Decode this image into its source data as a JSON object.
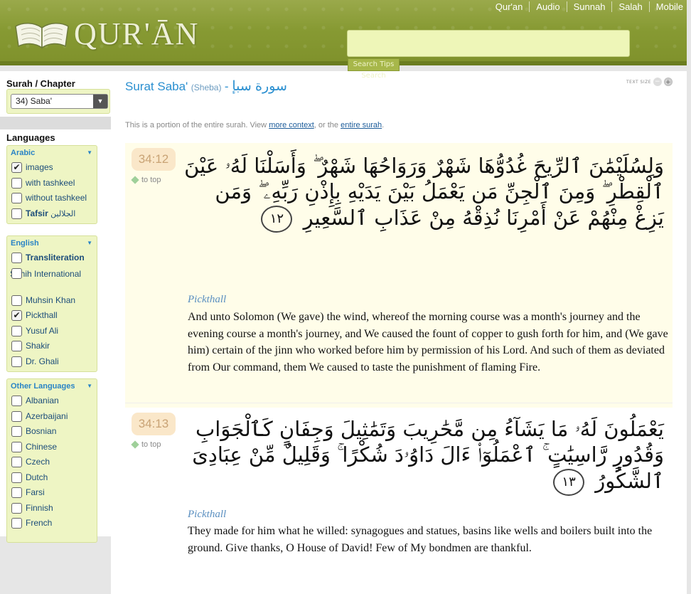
{
  "top_nav": [
    "Qur'an",
    "Audio",
    "Sunnah",
    "Salah",
    "Mobile"
  ],
  "logo": {
    "text": "QUR'ĀN"
  },
  "search": {
    "placeholder": "",
    "button_label": "Search Tips Search"
  },
  "sidebar": {
    "surah_heading": "Surah / Chapter",
    "surah_selected": "34) Saba'",
    "languages_heading": "Languages",
    "groups": [
      {
        "title": "Arabic",
        "items": [
          {
            "label": "images",
            "checked": true
          },
          {
            "label": "with tashkeel",
            "checked": false
          },
          {
            "label": "without tashkeel",
            "checked": false
          },
          {
            "label": "Tafsir",
            "extra": "الجلالين",
            "checked": false,
            "bold": true
          }
        ]
      },
      {
        "title": "English",
        "items": [
          {
            "label": "Transliteration",
            "checked": false,
            "bold": true
          },
          {
            "label": "Sahih International",
            "checked": false
          },
          {
            "label": "Muhsin Khan",
            "checked": false
          },
          {
            "label": "Pickthall",
            "checked": true
          },
          {
            "label": "Yusuf Ali",
            "checked": false
          },
          {
            "label": "Shakir",
            "checked": false
          },
          {
            "label": "Dr. Ghali",
            "checked": false
          }
        ]
      },
      {
        "title": "Other Languages",
        "items": [
          {
            "label": "Albanian",
            "checked": false
          },
          {
            "label": "Azerbaijani",
            "checked": false
          },
          {
            "label": "Bosnian",
            "checked": false
          },
          {
            "label": "Chinese",
            "checked": false
          },
          {
            "label": "Czech",
            "checked": false
          },
          {
            "label": "Dutch",
            "checked": false
          },
          {
            "label": "Farsi",
            "checked": false
          },
          {
            "label": "Finnish",
            "checked": false
          },
          {
            "label": "French",
            "checked": false
          }
        ]
      }
    ]
  },
  "main": {
    "title_en": "Surat Saba'",
    "title_sub": "(Sheba)",
    "title_dash": " - ",
    "title_ar": "سورة سبإ",
    "text_size_label": "TEXT SIZE",
    "portion_prefix": "This is a portion of the entire surah. View ",
    "portion_link1": "more context",
    "portion_mid": ", or the ",
    "portion_link2": "entire surah",
    "portion_suffix": ".",
    "verses": [
      {
        "number": "34:12",
        "to_top": "to top",
        "arabic": "وَلِسُلَيْمَٰنَ ٱلرِّيحَ غُدُوُّهَا شَهْرٌ وَرَوَاحُهَا شَهْرٌ ۖ وَأَسَلْنَا لَهُۥ عَيْنَ ٱلْقِطْرِ ۖ وَمِنَ ٱلْجِنِّ مَن يَعْمَلُ بَيْنَ يَدَيْهِ بِإِذْنِ رَبِّهِۦ ۖ وَمَن يَزِغْ مِنْهُمْ عَنْ أَمْرِنَا نُذِقْهُ مِنْ عَذَابِ ٱلسَّعِيرِ",
        "ayah_mark": "١٢",
        "translator": "Pickthall",
        "translation": "And unto Solomon (We gave) the wind, whereof the morning course was a month's journey and the evening course a month's journey, and We caused the fount of copper to gush forth for him, and (We gave him) certain of the jinn who worked before him by permission of his Lord. And such of them as deviated from Our command, them We caused to taste the punishment of flaming Fire."
      },
      {
        "number": "34:13",
        "to_top": "to top",
        "arabic": "يَعْمَلُونَ لَهُۥ مَا يَشَآءُ مِن مَّحَٰرِيبَ وَتَمَٰثِيلَ وَجِفَانٍ كَٱلْجَوَابِ وَقُدُورٍ رَّاسِيَٰتٍ ۚ ٱعْمَلُوٓا۟ ءَالَ دَاوُۥدَ شُكْرًا ۚ وَقَلِيلٌ مِّنْ عِبَادِىَ ٱلشَّكُورُ",
        "ayah_mark": "١٣",
        "translator": "Pickthall",
        "translation": "They made for him what he willed: synagogues and statues, basins like wells and boilers built into the ground. Give thanks, O House of David! Few of My bondmen are thankful."
      }
    ]
  },
  "colors": {
    "header_green": "#879a33",
    "link_blue": "#2a8fd0",
    "verse_bg": "#fffde9",
    "verse_num_bg": "#fae7c9"
  }
}
